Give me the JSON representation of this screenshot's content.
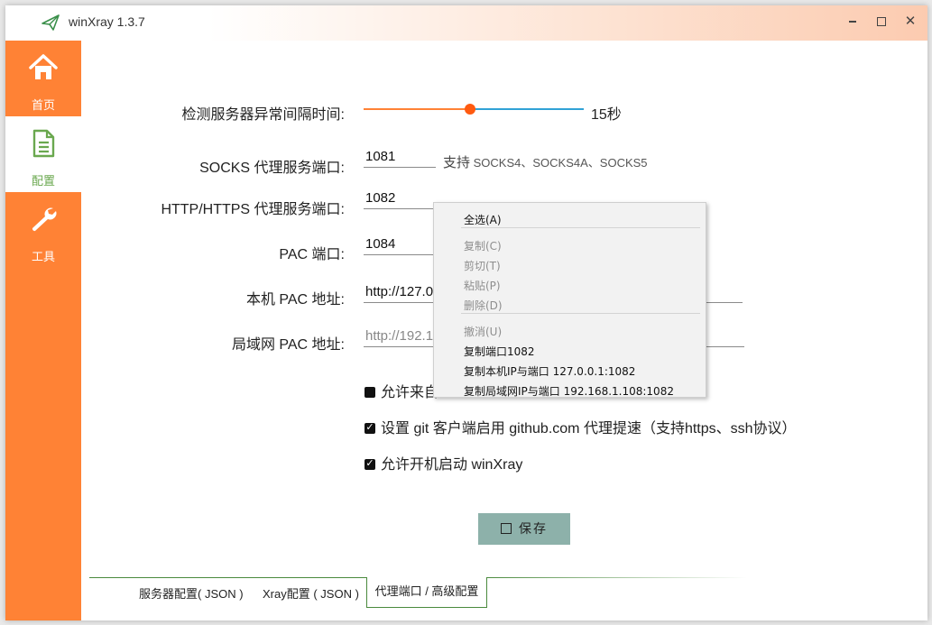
{
  "window": {
    "title": "winXray 1.3.7"
  },
  "sidebar": {
    "items": [
      {
        "label": "首页",
        "icon": "home-icon"
      },
      {
        "label": "配置",
        "icon": "document-icon"
      },
      {
        "label": "工具",
        "icon": "wrench-icon"
      }
    ]
  },
  "form": {
    "interval_label": "检测服务器异常间隔时间:",
    "interval_value": "15秒",
    "interval_fraction": 0.48,
    "socks_label": "SOCKS 代理服务端口:",
    "socks_value": "1081",
    "socks_note_prefix": "支持",
    "socks_note": "SOCKS4、SOCKS4A、SOCKS5",
    "http_label": "HTTP/HTTPS 代理服务端口:",
    "http_value": "1082",
    "pac_label": "PAC 端口:",
    "pac_value": "1084",
    "local_pac_label": "本机 PAC 地址:",
    "local_pac_value": "http://127.0",
    "lan_pac_label": "局域网 PAC 地址:",
    "lan_pac_value": "http://192.1",
    "allow_lan_label": "允许来自",
    "git_proxy_label": "设置 git 客户端启用 github.com 代理提速（支持https、ssh协议）",
    "autostart_label": "允许开机启动 winXray",
    "save_label": "保存"
  },
  "tabs": {
    "server_config": "服务器配置( JSON )",
    "xray_config": "Xray配置 ( JSON )",
    "proxy_port": "代理端口 / 高级配置"
  },
  "context_menu": {
    "select_all": "全选(A)",
    "copy": "复制(C)",
    "cut": "剪切(T)",
    "paste": "粘贴(P)",
    "delete": "删除(D)",
    "undo": "撤消(U)",
    "copy_port": "复制端口1082",
    "copy_local_ip_port": "复制本机IP与端口 127.0.0.1:1082",
    "copy_lan_ip_port": "复制局域网IP与端口 192.168.1.108:1082"
  },
  "colors": {
    "accent": "#ff8235",
    "active_nav_text": "#6aa84f",
    "save_button": "#8db1aa",
    "slider_right": "#31a2d6"
  }
}
